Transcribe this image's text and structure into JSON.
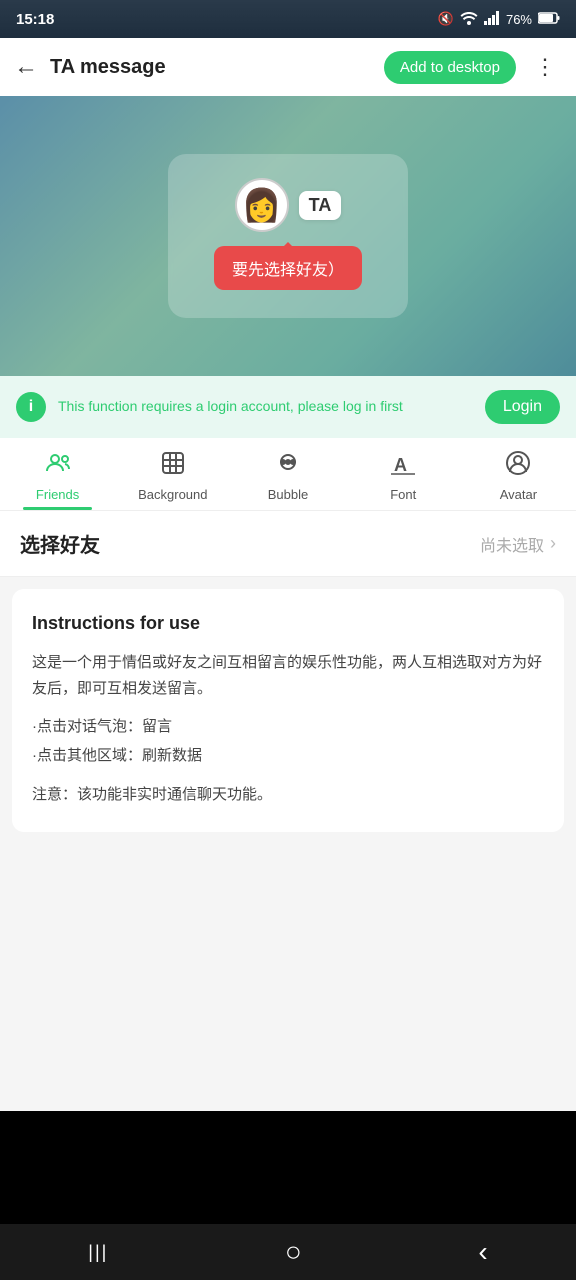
{
  "statusBar": {
    "time": "15:18",
    "battery": "76%"
  },
  "header": {
    "title": "TA message",
    "backIcon": "←",
    "addToDesktopLabel": "Add to desktop",
    "moreIcon": "⋮"
  },
  "preview": {
    "taBadge": "TA",
    "bubbleText": "要先选择好友）",
    "avatarEmoji": "👩"
  },
  "loginNotice": {
    "infoIcon": "i",
    "text": "This function requires a login account, please log in first",
    "loginLabel": "Login"
  },
  "tabs": [
    {
      "id": "friends",
      "label": "Friends",
      "active": true
    },
    {
      "id": "background",
      "label": "Background",
      "active": false
    },
    {
      "id": "bubble",
      "label": "Bubble",
      "active": false
    },
    {
      "id": "font",
      "label": "Font",
      "active": false
    },
    {
      "id": "avatar",
      "label": "Avatar",
      "active": false
    }
  ],
  "selectFriend": {
    "label": "选择好友",
    "placeholder": "尚未选取",
    "chevron": "›"
  },
  "instructions": {
    "title": "Instructions for use",
    "paragraph1": "这是一个用于情侣或好友之间互相留言的娱乐性功能，两人互相选取对方为好友后，即可互相发送留言。",
    "detail1": "·点击对话气泡：留言",
    "detail2": "·点击其他区域：刷新数据",
    "note": "注意：该功能非实时通信聊天功能。"
  },
  "bottomNav": {
    "backIcon": "‹",
    "homeIcon": "○",
    "recentIcon": "|||"
  }
}
